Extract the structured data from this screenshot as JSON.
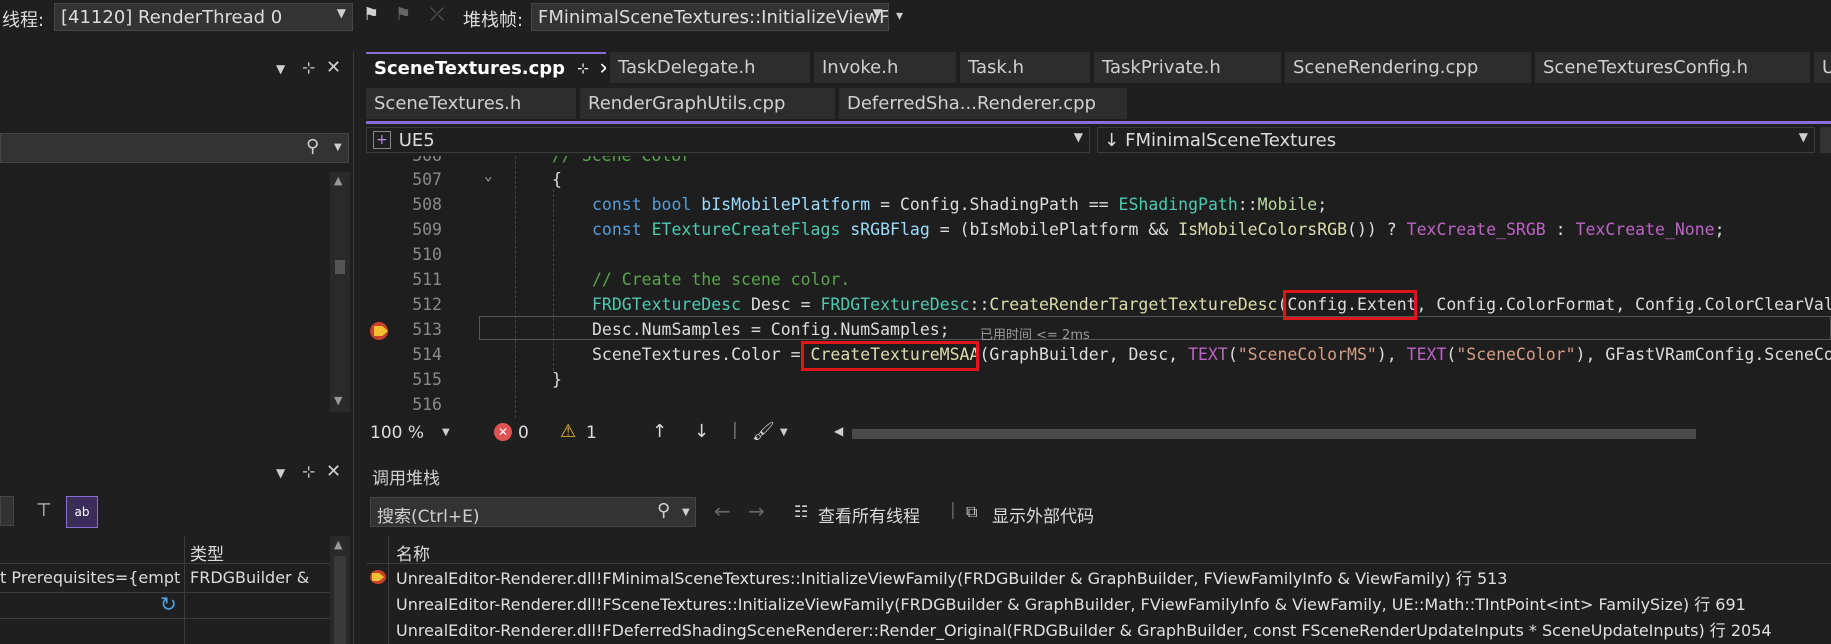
{
  "toolbar": {
    "thread_label": "线程:",
    "thread_value": "[41120] RenderThread 0",
    "stackframe_label": "堆栈帧:",
    "stackframe_value": "FMinimalSceneTextures::InitializeViewF"
  },
  "tabs_row1": [
    {
      "label": "SceneTextures.cpp",
      "pin": "⊹",
      "close": "✕"
    },
    {
      "label": "TaskDelegate.h"
    },
    {
      "label": "Invoke.h"
    },
    {
      "label": "Task.h"
    },
    {
      "label": "TaskPrivate.h"
    },
    {
      "label": "SceneRendering.cpp"
    },
    {
      "label": "SceneTexturesConfig.h"
    },
    {
      "label": "U"
    }
  ],
  "tabs_row2": [
    {
      "label": "SceneTextures.h"
    },
    {
      "label": "RenderGraphUtils.cpp"
    },
    {
      "label": "DeferredSha...Renderer.cpp"
    }
  ],
  "nav": {
    "project": "UE5",
    "scope": "FMinimalSceneTextures"
  },
  "code_lines": [
    {
      "num": "506",
      "text": "// Scene Color"
    },
    {
      "num": "507",
      "text": "{"
    },
    {
      "num": "508"
    },
    {
      "num": "509"
    },
    {
      "num": "510"
    },
    {
      "num": "511",
      "text": "// Create the scene color."
    },
    {
      "num": "512"
    },
    {
      "num": "513",
      "elapsed": "已用时间 <= 2ms"
    },
    {
      "num": "514"
    },
    {
      "num": "515",
      "text": "}"
    },
    {
      "num": "516"
    }
  ],
  "status": {
    "zoom": "100 %",
    "errors": "0",
    "warnings": "1"
  },
  "left_panel": {
    "type_header": "类型",
    "row_text": "t Prerequisites={empt",
    "row_type": "FRDGBuilder &"
  },
  "callstack": {
    "title": "调用堆栈",
    "search_placeholder": "搜索(Ctrl+E)",
    "view_all_threads": "查看所有线程",
    "show_external": "显示外部代码",
    "col_name": "名称",
    "rows": [
      "UnrealEditor-Renderer.dll!FMinimalSceneTextures::InitializeViewFamily(FRDGBuilder & GraphBuilder, FViewFamilyInfo & ViewFamily) 行 513",
      "UnrealEditor-Renderer.dll!FSceneTextures::InitializeViewFamily(FRDGBuilder & GraphBuilder, FViewFamilyInfo & ViewFamily, UE::Math::TIntPoint<int> FamilySize) 行 691",
      "UnrealEditor-Renderer.dll!FDeferredShadingSceneRenderer::Render_Original(FRDGBuilder & GraphBuilder, const FSceneRenderUpdateInputs * SceneUpdateInputs) 行 2054"
    ]
  },
  "colors": {
    "accent": "#8c6cd6",
    "highlight_box": "#e0161b",
    "background": "#1f1f1f"
  }
}
